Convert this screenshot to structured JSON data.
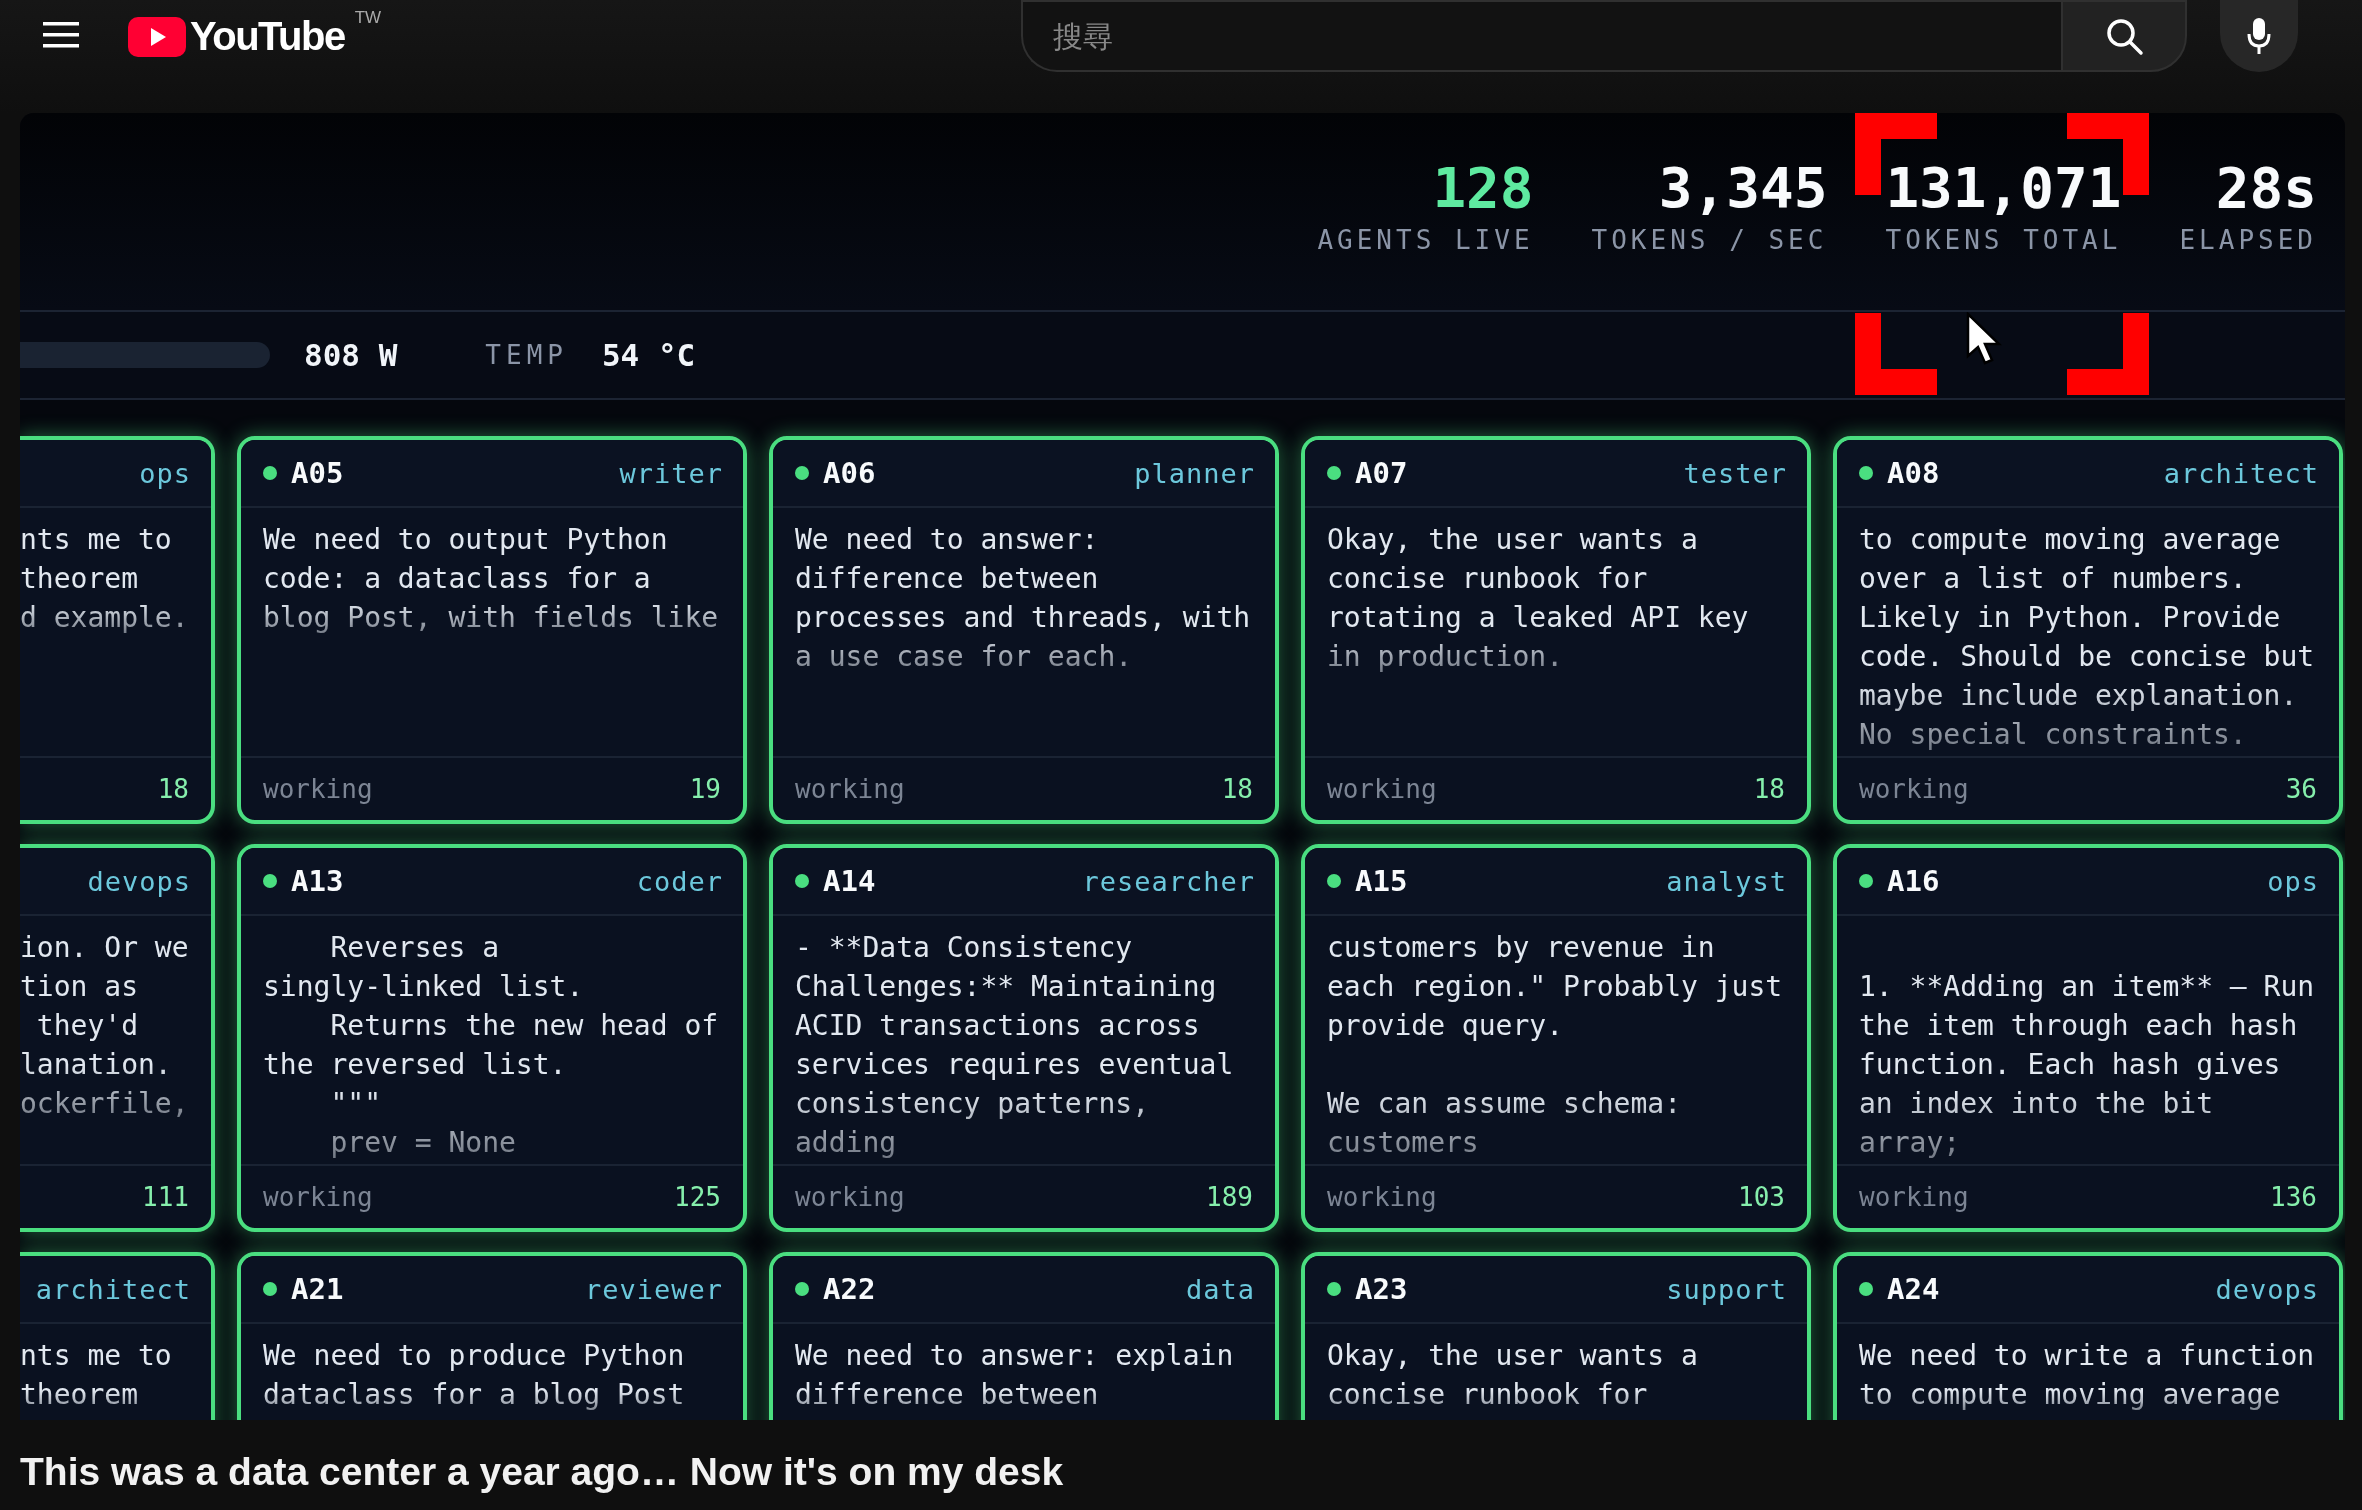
{
  "header": {
    "logo": "YouTube",
    "region": "TW",
    "search": {
      "placeholder": "搜尋"
    }
  },
  "video": {
    "stats": [
      {
        "value": "128",
        "label": "AGENTS LIVE",
        "kind": "accent",
        "highlighted": false
      },
      {
        "value": "3,345",
        "label": "TOKENS / SEC",
        "kind": "plain",
        "highlighted": false
      },
      {
        "value": "131,071",
        "label": "TOKENS TOTAL",
        "kind": "plain",
        "highlighted": true
      },
      {
        "value": "28s",
        "label": "ELAPSED",
        "kind": "plain",
        "highlighted": false
      }
    ],
    "power": {
      "reading": "808 W"
    },
    "temp": {
      "label": "TEMP",
      "value": "54 °C"
    },
    "rows": [
      [
        {
          "kind": "partial",
          "role": "ops",
          "text": "nts me to\ntheorem\nd example.",
          "count": "18"
        },
        {
          "kind": "full",
          "id": "A05",
          "role": "writer",
          "text": "We need to output Python\ncode: a dataclass for a\nblog Post, with fields like",
          "status": "working",
          "count": "19"
        },
        {
          "kind": "full",
          "id": "A06",
          "role": "planner",
          "text": "We need to answer:\ndifference between\nprocesses and threads, with\na use case for each.",
          "status": "working",
          "count": "18"
        },
        {
          "kind": "full",
          "id": "A07",
          "role": "tester",
          "text": "Okay, the user wants a\nconcise runbook for\nrotating a leaked API key\nin production.",
          "status": "working",
          "count": "18"
        },
        {
          "kind": "full",
          "id": "A08",
          "role": "architect",
          "text": "to compute moving average\nover a list of numbers.\nLikely in Python. Provide\ncode. Should be concise but\nmaybe include explanation.\nNo special constraints.",
          "status": "working",
          "count": "36"
        }
      ],
      [
        {
          "kind": "partial",
          "role": "devops",
          "text": "ion. Or we\ntion as\n they'd\nlanation.\nockerfile,",
          "count": "111"
        },
        {
          "kind": "full",
          "id": "A13",
          "role": "coder",
          "text": "    Reverses a\nsingly-linked list.\n    Returns the new head of\nthe reversed list.\n    \"\"\"\n    prev = None",
          "status": "working",
          "count": "125"
        },
        {
          "kind": "full",
          "id": "A14",
          "role": "researcher",
          "text": "- **Data Consistency\nChallenges:** Maintaining\nACID transactions across\nservices requires eventual\nconsistency patterns,\nadding",
          "status": "working",
          "count": "189"
        },
        {
          "kind": "full",
          "id": "A15",
          "role": "analyst",
          "text": "customers by revenue in\neach region.\" Probably just\nprovide query.\n\nWe can assume schema:\ncustomers",
          "status": "working",
          "count": "103"
        },
        {
          "kind": "full",
          "id": "A16",
          "role": "ops",
          "text": "\n1. **Adding an item** — Run\nthe item through each hash\nfunction. Each hash gives\nan index into the bit\narray;",
          "status": "working",
          "count": "136"
        }
      ],
      [
        {
          "kind": "partial",
          "role": "architect",
          "text": "nts me to\ntheorem"
        },
        {
          "kind": "full",
          "id": "A21",
          "role": "reviewer",
          "text": "We need to produce Python\ndataclass for a blog Post"
        },
        {
          "kind": "full",
          "id": "A22",
          "role": "data",
          "text": "We need to answer: explain\ndifference between"
        },
        {
          "kind": "full",
          "id": "A23",
          "role": "support",
          "text": "Okay, the user wants a\nconcise runbook for"
        },
        {
          "kind": "full",
          "id": "A24",
          "role": "devops",
          "text": "We need to write a function\nto compute moving average"
        }
      ]
    ]
  },
  "title": "This was a data center a year ago… Now it's on my desk"
}
